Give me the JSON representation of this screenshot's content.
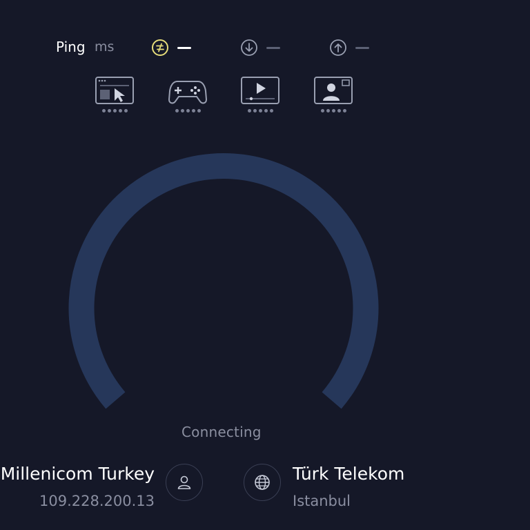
{
  "colors": {
    "background": "#151828",
    "gauge_track": "#26375a",
    "ping_accent": "#e8de7a",
    "muted": "#8a8ea0",
    "icon_gray": "#9aa0b2"
  },
  "metrics": {
    "ping_label": "Ping",
    "ping_unit": "ms",
    "ping_icon": "ping-icon",
    "ping_value": "—",
    "download_icon": "download-icon",
    "download_value": "—",
    "upload_icon": "upload-icon",
    "upload_value": "—"
  },
  "quality_icons": [
    {
      "name": "web-browsing-icon"
    },
    {
      "name": "gaming-icon"
    },
    {
      "name": "video-streaming-icon"
    },
    {
      "name": "video-call-icon"
    }
  ],
  "status": "Connecting",
  "isp": {
    "name": "Millenicom Turkey",
    "ip": "109.228.200.13",
    "icon": "user-icon"
  },
  "server": {
    "name": "Türk Telekom",
    "city": "Istanbul",
    "icon": "globe-icon"
  }
}
